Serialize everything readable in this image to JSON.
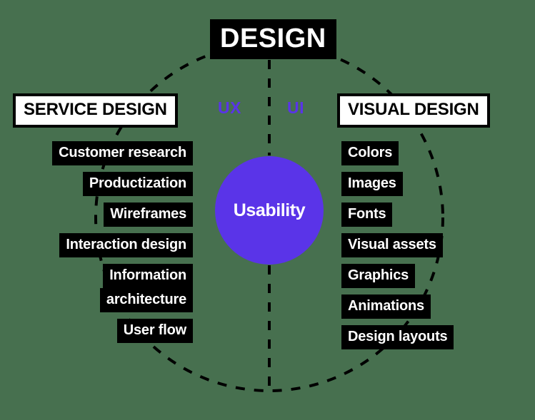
{
  "background_color": "#47704f",
  "accent_color": "#5a34e8",
  "box_color": "#000000",
  "box_text_color": "#ffffff",
  "header": {
    "title": "DESIGN"
  },
  "center": {
    "label": "Usability"
  },
  "middle_labels": {
    "ux": "UX",
    "ui": "UI"
  },
  "left_column": {
    "header": "SERVICE DESIGN",
    "items": [
      {
        "lines": [
          "Customer research"
        ]
      },
      {
        "lines": [
          "Productization"
        ]
      },
      {
        "lines": [
          "Wireframes"
        ]
      },
      {
        "lines": [
          "Interaction design"
        ]
      },
      {
        "lines": [
          "Information",
          "architecture"
        ]
      },
      {
        "lines": [
          "User flow"
        ]
      }
    ]
  },
  "right_column": {
    "header": "VISUAL DESIGN",
    "items": [
      {
        "lines": [
          "Colors"
        ]
      },
      {
        "lines": [
          "Images"
        ]
      },
      {
        "lines": [
          "Fonts"
        ]
      },
      {
        "lines": [
          "Visual assets"
        ]
      },
      {
        "lines": [
          "Graphics"
        ]
      },
      {
        "lines": [
          "Animations"
        ]
      },
      {
        "lines": [
          "Design layouts"
        ]
      }
    ]
  }
}
